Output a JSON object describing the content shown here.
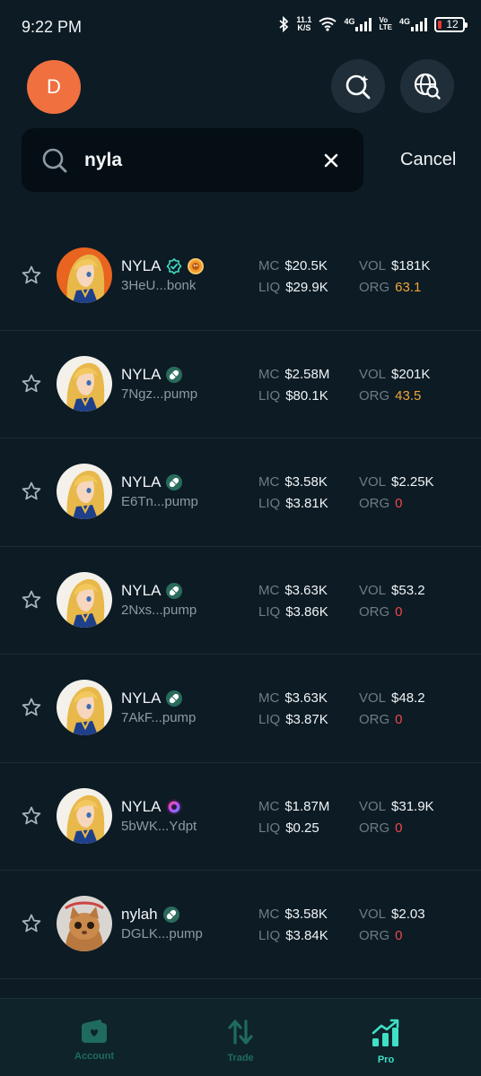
{
  "status_bar": {
    "time": "9:22 PM",
    "net_speed_value": "11.1",
    "net_speed_unit": "K/S",
    "sim1": "4G",
    "volte_top": "Vo",
    "volte_bottom": "LTE",
    "sim2": "4G",
    "battery": "12"
  },
  "header": {
    "avatar_letter": "D"
  },
  "search": {
    "value": "nyla",
    "cancel_label": "Cancel"
  },
  "tokens": [
    {
      "name": "NYLA",
      "address": "3HeU...bonk",
      "badges": [
        "verified-icon",
        "bonk-icon"
      ],
      "avatar": "orange",
      "mc_label": "MC",
      "mc": "$20.5K",
      "vol_label": "VOL",
      "vol": "$181K",
      "liq_label": "LIQ",
      "liq": "$29.9K",
      "org_label": "ORG",
      "org": "63.1",
      "org_color": "orange"
    },
    {
      "name": "NYLA",
      "address": "7Ngz...pump",
      "badges": [
        "pump-icon"
      ],
      "avatar": "white",
      "mc_label": "MC",
      "mc": "$2.58M",
      "vol_label": "VOL",
      "vol": "$201K",
      "liq_label": "LIQ",
      "liq": "$80.1K",
      "org_label": "ORG",
      "org": "43.5",
      "org_color": "orange"
    },
    {
      "name": "NYLA",
      "address": "E6Tn...pump",
      "badges": [
        "pump-icon"
      ],
      "avatar": "white",
      "mc_label": "MC",
      "mc": "$3.58K",
      "vol_label": "VOL",
      "vol": "$2.25K",
      "liq_label": "LIQ",
      "liq": "$3.81K",
      "org_label": "ORG",
      "org": "0",
      "org_color": "red"
    },
    {
      "name": "NYLA",
      "address": "2Nxs...pump",
      "badges": [
        "pump-icon"
      ],
      "avatar": "white",
      "mc_label": "MC",
      "mc": "$3.63K",
      "vol_label": "VOL",
      "vol": "$53.2",
      "liq_label": "LIQ",
      "liq": "$3.86K",
      "org_label": "ORG",
      "org": "0",
      "org_color": "red"
    },
    {
      "name": "NYLA",
      "address": "7AkF...pump",
      "badges": [
        "pump-icon"
      ],
      "avatar": "white",
      "mc_label": "MC",
      "mc": "$3.63K",
      "vol_label": "VOL",
      "vol": "$48.2",
      "liq_label": "LIQ",
      "liq": "$3.87K",
      "org_label": "ORG",
      "org": "0",
      "org_color": "red"
    },
    {
      "name": "NYLA",
      "address": "5bWK...Ydpt",
      "badges": [
        "launchpad-icon"
      ],
      "avatar": "white",
      "mc_label": "MC",
      "mc": "$1.87M",
      "vol_label": "VOL",
      "vol": "$31.9K",
      "liq_label": "LIQ",
      "liq": "$0.25",
      "org_label": "ORG",
      "org": "0",
      "org_color": "red"
    },
    {
      "name": "nylah",
      "address": "DGLK...pump",
      "badges": [
        "pump-icon"
      ],
      "avatar": "cat",
      "mc_label": "MC",
      "mc": "$3.58K",
      "vol_label": "VOL",
      "vol": "$2.03",
      "liq_label": "LIQ",
      "liq": "$3.84K",
      "org_label": "ORG",
      "org": "0",
      "org_color": "red"
    }
  ],
  "bottom_nav": [
    {
      "label": "Account",
      "icon": "wallet-icon",
      "active": false
    },
    {
      "label": "Trade",
      "icon": "swap-arrows-icon",
      "active": false
    },
    {
      "label": "Pro",
      "icon": "trend-chart-icon",
      "active": true
    }
  ],
  "colors": {
    "background": "#0c1b24",
    "accent": "#3fe0c5",
    "avatar": "#f0703f",
    "org_positive": "#f0a43a",
    "org_zero": "#ef4848"
  }
}
